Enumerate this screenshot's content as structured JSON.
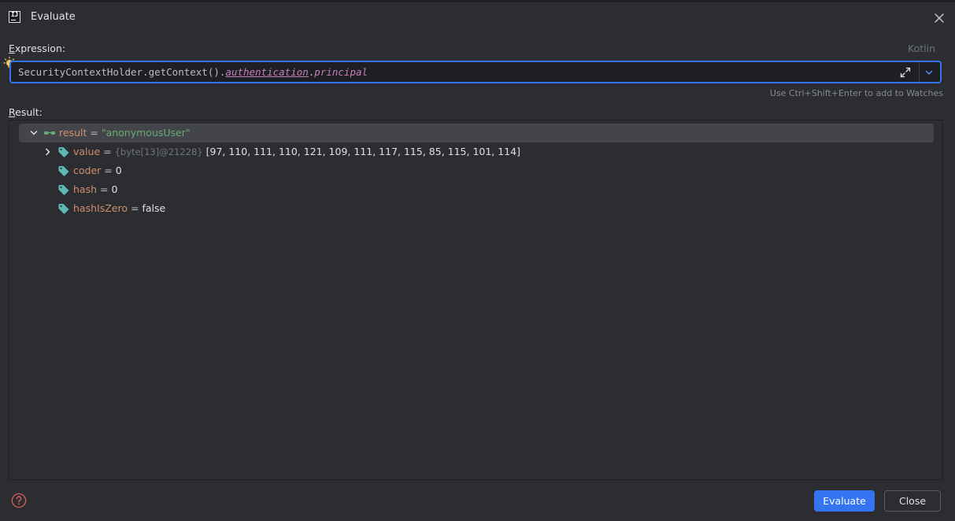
{
  "window": {
    "title": "Evaluate",
    "app_icon": "intellij-idea-icon",
    "close_icon": "close-icon"
  },
  "expression": {
    "label_prefix": "",
    "label_accel": "E",
    "label_rest": "xpression:",
    "language": "Kotlin",
    "bulb_icon": "lightbulb-icon",
    "value_part1": "SecurityContextHolder.getContext().",
    "value_part2": "authentication",
    "value_part3": ".",
    "value_part4": "principal",
    "expand_icon": "expand-icon",
    "history_icon": "chevron-down-icon",
    "hint": "Use Ctrl+Shift+Enter to add to Watches"
  },
  "result": {
    "label_accel": "R",
    "label_rest": "esult:",
    "root": {
      "name": "result",
      "eq": "=",
      "value": "\"anonymousUser\"",
      "icon": "watch-glasses-icon",
      "expanded": true
    },
    "children": [
      {
        "name": "value",
        "eq": "=",
        "ref": "{byte[13]@21228}",
        "value": "[97, 110, 111, 110, 121, 109, 111, 117, 115, 85, 115, 101, 114]",
        "icon": "field-tag-icon",
        "expandable": true
      },
      {
        "name": "coder",
        "eq": "=",
        "ref": "",
        "value": "0",
        "icon": "field-tag-icon",
        "expandable": false
      },
      {
        "name": "hash",
        "eq": "=",
        "ref": "",
        "value": "0",
        "icon": "field-tag-icon",
        "expandable": false
      },
      {
        "name": "hashIsZero",
        "eq": "=",
        "ref": "",
        "value": "false",
        "icon": "field-tag-icon",
        "expandable": false
      }
    ]
  },
  "footer": {
    "help_icon": "help-icon",
    "evaluate_label": "Evaluate",
    "close_label": "Close"
  },
  "colors": {
    "background": "#2b2d30",
    "editor_background": "#1e1f22",
    "accent": "#3574f0",
    "field_name": "#cf8e6d",
    "string_value": "#6aab73",
    "property": "#c77dbb",
    "icon_tag": "#5fb8b3",
    "help_red": "#db5c5c"
  }
}
